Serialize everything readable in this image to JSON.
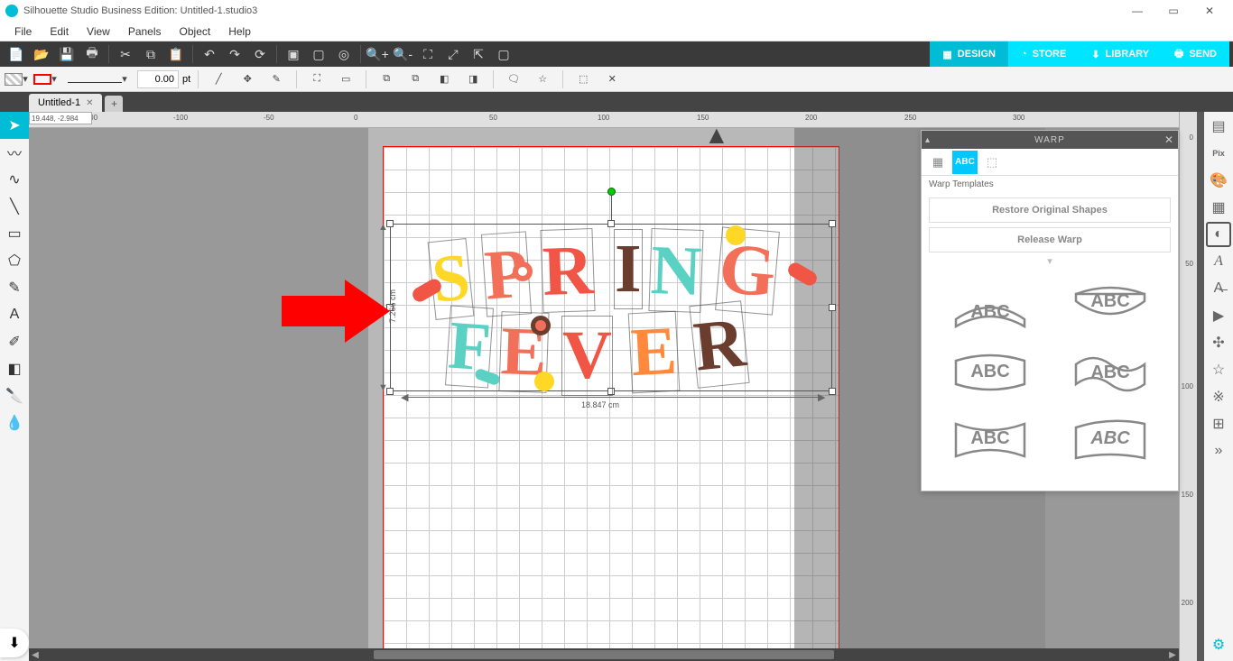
{
  "app": {
    "title": "Silhouette Studio Business Edition: Untitled-1.studio3",
    "doc_tab": "Untitled-1",
    "coords": "19.448, -2.984"
  },
  "menu": {
    "file": "File",
    "edit": "Edit",
    "view": "View",
    "panels": "Panels",
    "object": "Object",
    "help": "Help"
  },
  "nav": {
    "design": "DESIGN",
    "store": "STORE",
    "library": "LIBRARY",
    "send": "SEND"
  },
  "toolbar2": {
    "stroke_width": "0.00",
    "stroke_unit": "pt"
  },
  "ruler": {
    "h": [
      "-200",
      "-100",
      "-50",
      "0",
      "50",
      "100",
      "150",
      "200",
      "250",
      "300"
    ],
    "v": [
      "0",
      "50",
      "100",
      "150",
      "200"
    ]
  },
  "artwork": {
    "line1": "SPRING",
    "line2": "FEVER",
    "width_label": "18.847 cm",
    "height_label": "7.266 cm"
  },
  "warp": {
    "title": "WARP",
    "tab_abc": "ABC",
    "subtitle": "Warp Templates",
    "btn_restore": "Restore Original Shapes",
    "btn_release": "Release Warp"
  }
}
